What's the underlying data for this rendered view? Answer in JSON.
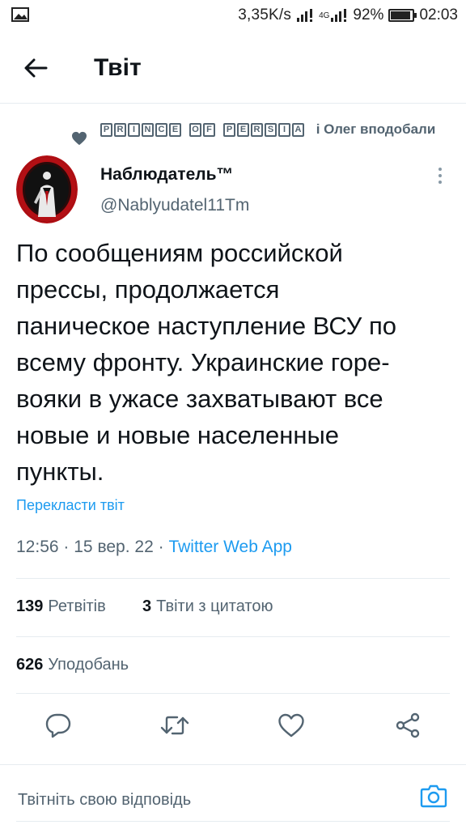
{
  "status_bar": {
    "speed": "3,35K/s",
    "network": "4G",
    "battery": "92%",
    "battery_level": 0.92,
    "time": "02:03",
    "icons": [
      "gallery-icon",
      "signal-icon",
      "signal-4g-icon",
      "battery-icon"
    ]
  },
  "header": {
    "title": "Твіт",
    "back_icon": "arrow-left-icon"
  },
  "social_context": {
    "liked_by_name_words": [
      [
        "P",
        "R",
        "I",
        "N",
        "C",
        "E"
      ],
      [
        "O",
        "F"
      ],
      [
        "P",
        "E",
        "R",
        "S",
        "I",
        "A"
      ]
    ],
    "liked_text": "і Олег вподобали",
    "icon": "heart-icon"
  },
  "author": {
    "name": "Наблюдатель™",
    "handle": "@Nablyudatel11Tm"
  },
  "tweet": {
    "text": "По сообщениям российской\nпрессы, продолжается\nпаническое наступление ВСУ по\nвсему фронту. Украинские горе-\nвояки в ужасе захватывают все\nновые и новые населенные\nпункты.",
    "translate": "Перекласти твіт",
    "time": "12:56",
    "date": "15 вер. 22",
    "separator": "·",
    "source": "Twitter Web App"
  },
  "stats": {
    "retweets_count": "139",
    "retweets_label": "Ретвітів",
    "quotes_count": "3",
    "quotes_label": "Твіти з цитатою",
    "likes_count": "626",
    "likes_label": "Уподобань"
  },
  "actions": [
    "reply-icon",
    "retweet-icon",
    "like-icon",
    "share-icon"
  ],
  "reply": {
    "placeholder": "Твітніть свою відповідь",
    "camera_icon": "camera-icon"
  },
  "colors": {
    "accent": "#1d9bf0",
    "secondary_text": "#536471",
    "primary_text": "#0f1419",
    "divider": "#e6ecf0"
  }
}
